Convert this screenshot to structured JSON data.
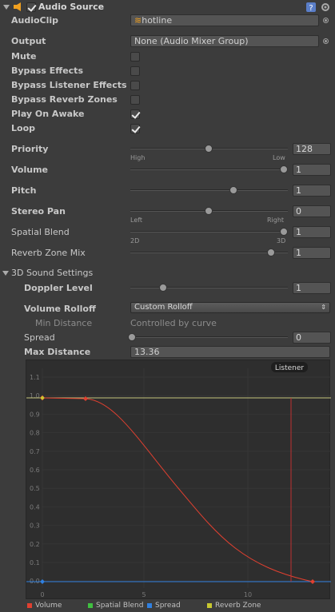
{
  "header": {
    "title": "Audio Source",
    "enabled": true
  },
  "fields": {
    "audioclip": {
      "label": "AudioClip",
      "value": "hotline"
    },
    "output": {
      "label": "Output",
      "value": "None (Audio Mixer Group)"
    },
    "mute": {
      "label": "Mute",
      "checked": false
    },
    "bypass_effects": {
      "label": "Bypass Effects",
      "checked": false
    },
    "bypass_listener": {
      "label": "Bypass Listener Effects",
      "checked": false
    },
    "bypass_reverb": {
      "label": "Bypass Reverb Zones",
      "checked": false
    },
    "play_on_awake": {
      "label": "Play On Awake",
      "checked": true
    },
    "loop": {
      "label": "Loop",
      "checked": true
    }
  },
  "sliders": {
    "priority": {
      "label": "Priority",
      "value": "128",
      "left": "High",
      "right": "Low",
      "fraction": 0.5
    },
    "volume": {
      "label": "Volume",
      "value": "1",
      "fraction": 1.0
    },
    "pitch": {
      "label": "Pitch",
      "value": "1",
      "fraction": 0.667
    },
    "stereo_pan": {
      "label": "Stereo Pan",
      "value": "0",
      "left": "Left",
      "right": "Right",
      "fraction": 0.5
    },
    "spatial_blend": {
      "label": "Spatial Blend",
      "value": "1",
      "left": "2D",
      "right": "3D",
      "fraction": 1.0
    },
    "reverb_zone_mix": {
      "label": "Reverb Zone Mix",
      "value": "1",
      "fraction": 0.91
    }
  },
  "sound3d": {
    "title": "3D Sound Settings",
    "doppler": {
      "label": "Doppler Level",
      "value": "1",
      "fraction": 0.2
    },
    "rolloff": {
      "label": "Volume Rolloff",
      "value": "Custom Rolloff"
    },
    "min_distance": {
      "label": "Min Distance",
      "value": "Controlled by curve"
    },
    "spread": {
      "label": "Spread",
      "value": "0",
      "fraction": 0.0
    },
    "max_distance": {
      "label": "Max Distance",
      "value": "13.36"
    }
  },
  "graph": {
    "listener_label": "Listener",
    "y_ticks": [
      "1.1",
      "1.0",
      "0.9",
      "0.8",
      "0.7",
      "0.6",
      "0.5",
      "0.4",
      "0.3",
      "0.2",
      "0.1",
      "0.0"
    ],
    "x_ticks": [
      "0",
      "5",
      "10"
    ],
    "colors": {
      "volume": "#e04030",
      "spatial": "#40c040",
      "spread": "#3080e0",
      "reverb": "#c8c830",
      "listener": "#c03030"
    },
    "legend": [
      "Volume",
      "Spatial Blend",
      "Spread",
      "Reverb Zone"
    ]
  }
}
